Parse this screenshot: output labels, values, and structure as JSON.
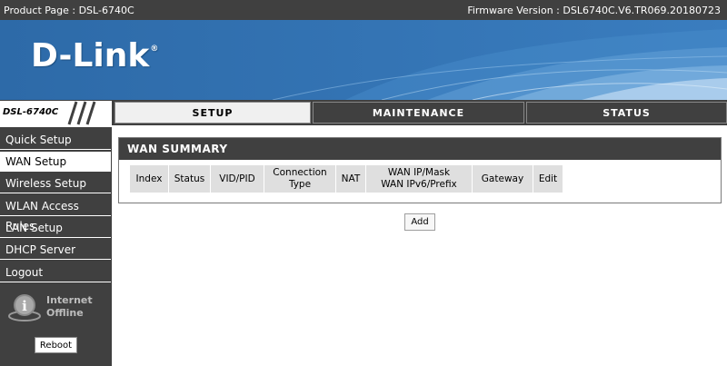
{
  "topbar": {
    "product_label": "Product Page : DSL-6740C",
    "firmware_label": "Firmware Version :  DSL6740C.V6.TR069.20180723"
  },
  "banner": {
    "logo_text": "D-Link",
    "logo_mark": "®"
  },
  "model_badge": "DSL-6740C",
  "tabs": [
    {
      "label": "SETUP",
      "active": true
    },
    {
      "label": "MAINTENANCE",
      "active": false
    },
    {
      "label": "STATUS",
      "active": false
    }
  ],
  "sidebar": {
    "items": [
      {
        "label": "Quick Setup",
        "active": false
      },
      {
        "label": "WAN Setup",
        "active": true
      },
      {
        "label": "Wireless Setup",
        "active": false
      },
      {
        "label": "WLAN Access Rules",
        "active": false
      },
      {
        "label": "LAN Setup",
        "active": false
      },
      {
        "label": "DHCP Server",
        "active": false
      },
      {
        "label": "Logout",
        "active": false
      }
    ],
    "internet_status": {
      "line1": "Internet",
      "line2": "Offline",
      "icon": "info-globe-icon"
    },
    "reboot_label": "Reboot"
  },
  "main": {
    "section_title": "WAN SUMMARY",
    "columns": [
      {
        "line1": "Index",
        "line2": ""
      },
      {
        "line1": "Status",
        "line2": ""
      },
      {
        "line1": "VID/PID",
        "line2": ""
      },
      {
        "line1": "Connection",
        "line2": "Type"
      },
      {
        "line1": "NAT",
        "line2": ""
      },
      {
        "line1": "WAN IP/Mask",
        "line2": "WAN IPv6/Prefix"
      },
      {
        "line1": "Gateway",
        "line2": ""
      },
      {
        "line1": "Edit",
        "line2": ""
      }
    ],
    "add_label": "Add"
  },
  "colors": {
    "dark_bar": "#404040",
    "banner_blue": "#2f6fae",
    "table_header_bg": "#dfdfdf"
  }
}
